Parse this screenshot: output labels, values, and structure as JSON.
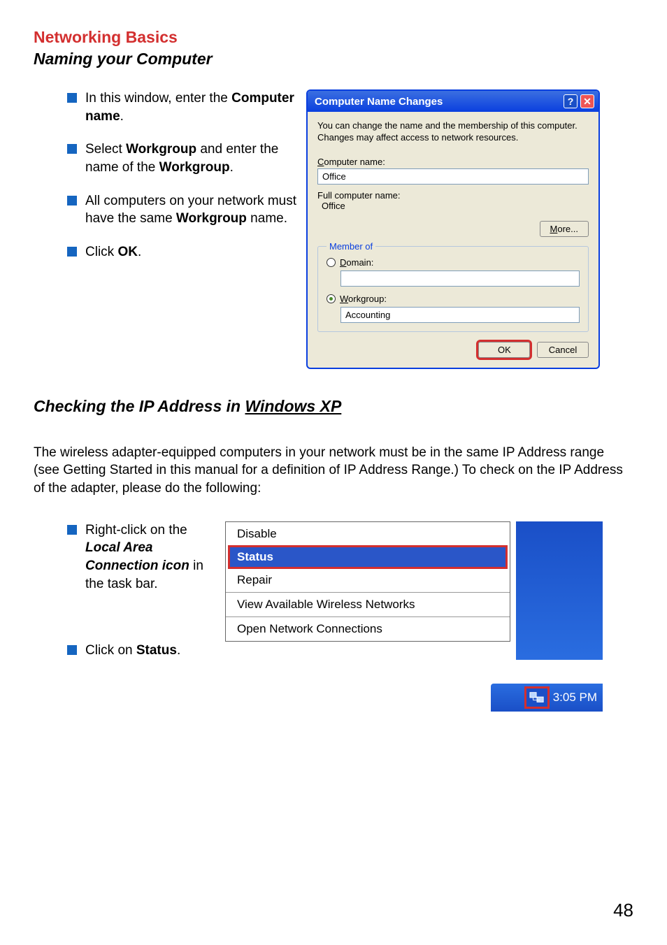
{
  "header": {
    "title_red": "Networking Basics",
    "subtitle": "Naming your Computer"
  },
  "left_bullets": [
    {
      "pre": "In this window, enter the ",
      "bold": "Computer name",
      "post": "."
    },
    {
      "pre": "Select ",
      "bold": "Workgroup",
      "mid": " and enter the name of the ",
      "bold2": "Workgroup",
      "post": "."
    },
    {
      "pre": "All computers on your network must have the same ",
      "bold": "Workgroup",
      "post": " name."
    },
    {
      "pre": "Click ",
      "bold": "OK",
      "post": "."
    }
  ],
  "dialog": {
    "title": "Computer Name Changes",
    "description": "You can change the name and the membership of this computer. Changes may affect access to network resources.",
    "computer_name_label_pre": "C",
    "computer_name_label_rest": "omputer name:",
    "computer_name_value": "Office",
    "full_name_label": "Full computer name:",
    "full_name_value": "Office",
    "more_button": "More...",
    "member_of_legend": "Member of",
    "domain_label_pre": "D",
    "domain_label_rest": "omain:",
    "domain_value": "",
    "workgroup_label_pre": "W",
    "workgroup_label_rest": "orkgroup:",
    "workgroup_value": "Accounting",
    "ok": "OK",
    "cancel": "Cancel"
  },
  "section2": {
    "title_pre": "Checking the IP Address in ",
    "title_uline": "Windows XP",
    "paragraph": "The wireless adapter-equipped computers in your network must be in the same IP Address range (see Getting Started in this manual for a definition of IP Address Range.)  To check on the IP Address of the adapter, please do the following:"
  },
  "bottom_bullets": [
    {
      "pre": "Right-click on the ",
      "bolditalic": "Local Area Connection icon",
      "post": " in the task bar."
    },
    {
      "pre": "Click on ",
      "bold": "Status",
      "post": "."
    }
  ],
  "context_menu": {
    "disable": "Disable",
    "status": "Status",
    "repair": "Repair",
    "view_networks": "View Available Wireless Networks",
    "open_connections": "Open Network Connections"
  },
  "taskbar": {
    "clock": "3:05 PM"
  },
  "page_number": "48"
}
